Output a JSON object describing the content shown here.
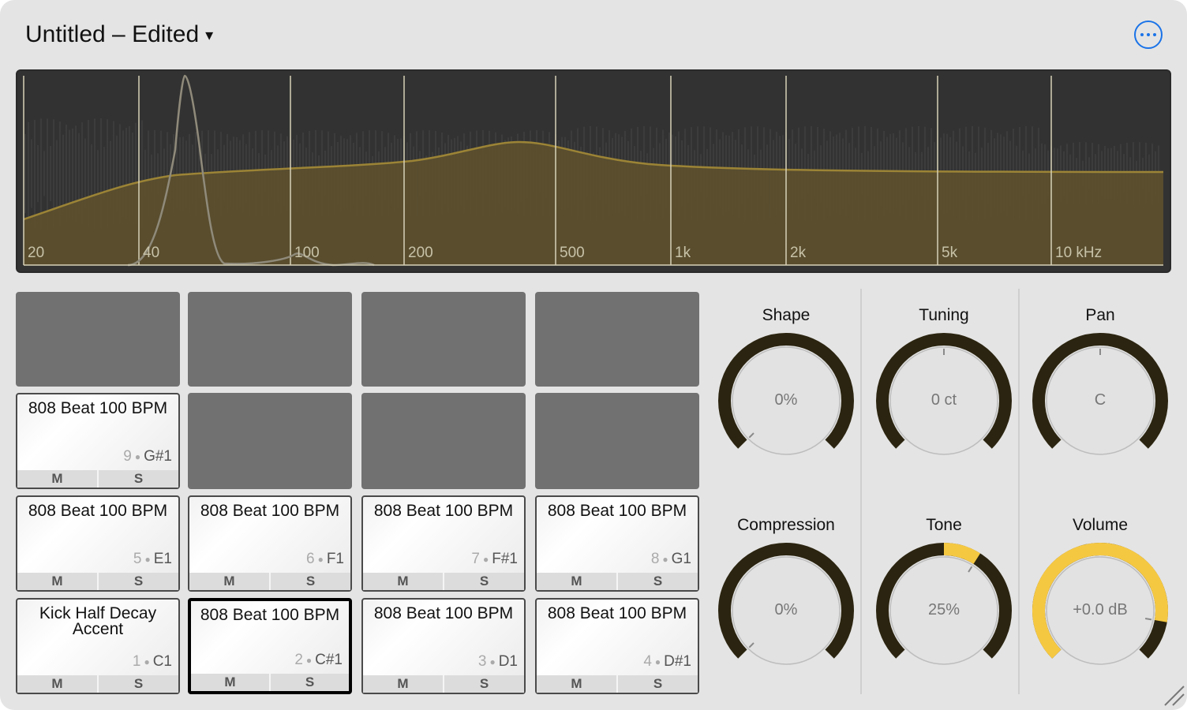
{
  "title": {
    "text": "Untitled – Edited",
    "caret": "▾"
  },
  "more_button": {
    "icon": "ellipsis-icon",
    "color": "#1a73e8"
  },
  "spectrum": {
    "freq_labels": [
      "20",
      "40",
      "100",
      "200",
      "500",
      "1k",
      "2k",
      "5k",
      "10 kHz"
    ],
    "fill_color": "#5c4f2e",
    "curve_color": "#9c8436",
    "grid_color": "#d8d2b8"
  },
  "pads": [
    {
      "row": 0,
      "col": 0,
      "empty": true
    },
    {
      "row": 0,
      "col": 1,
      "empty": true
    },
    {
      "row": 0,
      "col": 2,
      "empty": true
    },
    {
      "row": 0,
      "col": 3,
      "empty": true
    },
    {
      "row": 1,
      "col": 0,
      "empty": false,
      "name": "808 Beat 100 BPM",
      "num": "9",
      "note": "G#1",
      "m": "M",
      "s": "S"
    },
    {
      "row": 1,
      "col": 1,
      "empty": true
    },
    {
      "row": 1,
      "col": 2,
      "empty": true
    },
    {
      "row": 1,
      "col": 3,
      "empty": true
    },
    {
      "row": 2,
      "col": 0,
      "empty": false,
      "name": "808 Beat 100 BPM",
      "num": "5",
      "note": "E1",
      "m": "M",
      "s": "S"
    },
    {
      "row": 2,
      "col": 1,
      "empty": false,
      "name": "808 Beat 100 BPM",
      "num": "6",
      "note": "F1",
      "m": "M",
      "s": "S"
    },
    {
      "row": 2,
      "col": 2,
      "empty": false,
      "name": "808 Beat 100 BPM",
      "num": "7",
      "note": "F#1",
      "m": "M",
      "s": "S"
    },
    {
      "row": 2,
      "col": 3,
      "empty": false,
      "name": "808 Beat 100 BPM",
      "num": "8",
      "note": "G1",
      "m": "M",
      "s": "S"
    },
    {
      "row": 3,
      "col": 0,
      "empty": false,
      "name": "Kick Half Decay Accent",
      "num": "1",
      "note": "C1",
      "m": "M",
      "s": "S"
    },
    {
      "row": 3,
      "col": 1,
      "empty": false,
      "selected": true,
      "name": "808 Beat 100 BPM",
      "num": "2",
      "note": "C#1",
      "m": "M",
      "s": "S"
    },
    {
      "row": 3,
      "col": 2,
      "empty": false,
      "name": "808 Beat 100 BPM",
      "num": "3",
      "note": "D1",
      "m": "M",
      "s": "S"
    },
    {
      "row": 3,
      "col": 3,
      "empty": false,
      "name": "808 Beat 100 BPM",
      "num": "4",
      "note": "D#1",
      "m": "M",
      "s": "S"
    }
  ],
  "knobs": [
    {
      "label": "Shape",
      "value": "0%",
      "level": 0.0,
      "bipolar": false
    },
    {
      "label": "Tuning",
      "value": "0 ct",
      "level": 0.5,
      "bipolar": true
    },
    {
      "label": "Pan",
      "value": "C",
      "level": 0.5,
      "bipolar": true
    },
    {
      "label": "Compression",
      "value": "0%",
      "level": 0.0,
      "bipolar": false
    },
    {
      "label": "Tone",
      "value": "25%",
      "level": 0.62,
      "bipolar": true
    },
    {
      "label": "Volume",
      "value": "+0.0 dB",
      "level": 0.87,
      "bipolar": false
    }
  ],
  "colors": {
    "knob_track": "#2b2410",
    "knob_active": "#f5c842",
    "knob_face": "#e2e2e2"
  }
}
